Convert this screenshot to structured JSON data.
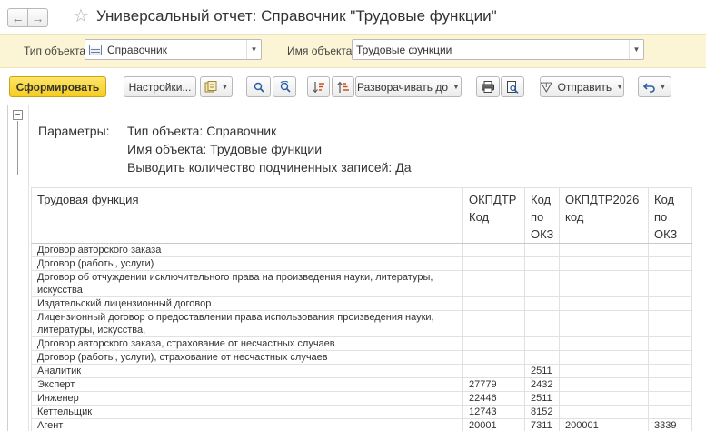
{
  "window": {
    "title": "Универсальный отчет: Справочник \"Трудовые функции\"",
    "nav_back_glyph": "←",
    "nav_forward_glyph": "→",
    "favorite_icon": "star-icon"
  },
  "params_bar": {
    "object_type_label": "Тип объекта:",
    "object_type_value": "Справочник",
    "object_name_label": "Имя объекта:",
    "object_name_value": "Трудовые функции"
  },
  "toolbar": {
    "generate_label": "Сформировать",
    "settings_label": "Настройки...",
    "expand_label": "Разворачивать до",
    "send_label": "Отправить",
    "icons": [
      "variants-icon",
      "search-icon",
      "search-next-icon",
      "sort-asc-icon",
      "sort-desc-icon",
      "print-icon",
      "print-preview-icon",
      "send-icon",
      "undo-icon"
    ]
  },
  "report": {
    "params": {
      "caption": "Параметры:",
      "lines": [
        "Тип объекта: Справочник",
        "Имя объекта: Трудовые функции",
        "Выводить количество подчиненных записей: Да"
      ]
    },
    "columns": [
      "Трудовая функция",
      "ОКПДТР Код",
      "Код по ОКЗ",
      "ОКПДТР2026 код",
      "Код по ОКЗ"
    ],
    "rows": [
      [
        "Договор авторского заказа",
        "",
        "",
        "",
        ""
      ],
      [
        "Договор (работы, услуги)",
        "",
        "",
        "",
        ""
      ],
      [
        "Договор об отчуждении исключительного права на произведения науки, литературы, искусства",
        "",
        "",
        "",
        ""
      ],
      [
        "Издательский лицензионный договор",
        "",
        "",
        "",
        ""
      ],
      [
        "Лицензионный договор о предоставлении права использования произведения науки, литературы, искусства,",
        "",
        "",
        "",
        ""
      ],
      [
        "Договор авторского заказа, страхование от несчастных случаев",
        "",
        "",
        "",
        ""
      ],
      [
        "Договор (работы, услуги), страхование от несчастных случаев",
        "",
        "",
        "",
        ""
      ],
      [
        "Аналитик",
        "",
        "2511",
        "",
        ""
      ],
      [
        "Эксперт",
        "27779",
        "2432",
        "",
        ""
      ],
      [
        "Инженер",
        "22446",
        "2511",
        "",
        ""
      ],
      [
        "Кеттельщик",
        "12743",
        "8152",
        "",
        ""
      ],
      [
        "Агент",
        "20001",
        "7311",
        "200001",
        "3339"
      ]
    ]
  }
}
